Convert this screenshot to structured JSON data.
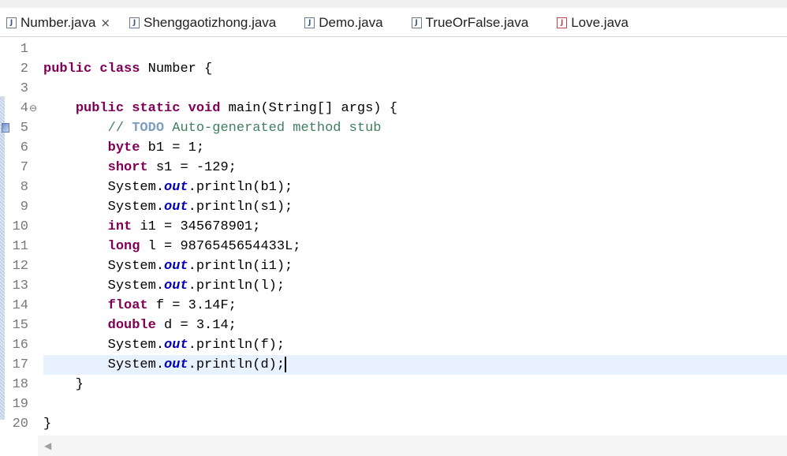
{
  "tabs": [
    {
      "label": "Number.java",
      "active": true,
      "icon": "java-file-icon",
      "icon_glyph": "J",
      "closable": true
    },
    {
      "label": "Shenggaotizhong.java",
      "active": false,
      "icon": "java-file-icon",
      "icon_glyph": "J"
    },
    {
      "label": "Demo.java",
      "active": false,
      "icon": "java-file-icon",
      "icon_glyph": "J"
    },
    {
      "label": "TrueOrFalse.java",
      "active": false,
      "icon": "java-file-icon",
      "icon_glyph": "J"
    },
    {
      "label": "Love.java",
      "active": false,
      "icon": "java-error-file-icon",
      "icon_glyph": "J"
    }
  ],
  "close_glyph": "×",
  "editor": {
    "current_line": 17,
    "fold_glyph": "⊖",
    "scroll_left_glyph": "◀",
    "lines": [
      {
        "n": "1",
        "tokens": []
      },
      {
        "n": "2",
        "tokens": [
          {
            "t": "public",
            "c": "kw"
          },
          {
            "t": " "
          },
          {
            "t": "class",
            "c": "kw"
          },
          {
            "t": " Number {"
          }
        ]
      },
      {
        "n": "3",
        "tokens": []
      },
      {
        "n": "4",
        "fold": true,
        "tokens": [
          {
            "t": "    "
          },
          {
            "t": "public",
            "c": "kw"
          },
          {
            "t": " "
          },
          {
            "t": "static",
            "c": "kw"
          },
          {
            "t": " "
          },
          {
            "t": "void",
            "c": "kw"
          },
          {
            "t": " main(String[] args) {"
          }
        ]
      },
      {
        "n": "5",
        "marker": true,
        "tokens": [
          {
            "t": "        "
          },
          {
            "t": "// ",
            "c": "cm"
          },
          {
            "t": "TODO",
            "c": "todo"
          },
          {
            "t": " Auto-generated method stub",
            "c": "cm"
          }
        ]
      },
      {
        "n": "6",
        "tokens": [
          {
            "t": "        "
          },
          {
            "t": "byte",
            "c": "kw"
          },
          {
            "t": " b1 = 1;"
          }
        ]
      },
      {
        "n": "7",
        "tokens": [
          {
            "t": "        "
          },
          {
            "t": "short",
            "c": "kw"
          },
          {
            "t": " s1 = -129;"
          }
        ]
      },
      {
        "n": "8",
        "tokens": [
          {
            "t": "        System."
          },
          {
            "t": "out",
            "c": "fld"
          },
          {
            "t": ".println(b1);"
          }
        ]
      },
      {
        "n": "9",
        "tokens": [
          {
            "t": "        System."
          },
          {
            "t": "out",
            "c": "fld"
          },
          {
            "t": ".println(s1);"
          }
        ]
      },
      {
        "n": "10",
        "tokens": [
          {
            "t": "        "
          },
          {
            "t": "int",
            "c": "kw"
          },
          {
            "t": " i1 = 345678901;"
          }
        ]
      },
      {
        "n": "11",
        "tokens": [
          {
            "t": "        "
          },
          {
            "t": "long",
            "c": "kw"
          },
          {
            "t": " l = 9876545654433L;"
          }
        ]
      },
      {
        "n": "12",
        "tokens": [
          {
            "t": "        System."
          },
          {
            "t": "out",
            "c": "fld"
          },
          {
            "t": ".println(i1);"
          }
        ]
      },
      {
        "n": "13",
        "tokens": [
          {
            "t": "        System."
          },
          {
            "t": "out",
            "c": "fld"
          },
          {
            "t": ".println(l);"
          }
        ]
      },
      {
        "n": "14",
        "tokens": [
          {
            "t": "        "
          },
          {
            "t": "float",
            "c": "kw"
          },
          {
            "t": " f = 3.14F;"
          }
        ]
      },
      {
        "n": "15",
        "tokens": [
          {
            "t": "        "
          },
          {
            "t": "double",
            "c": "kw"
          },
          {
            "t": " d = 3.14;"
          }
        ]
      },
      {
        "n": "16",
        "tokens": [
          {
            "t": "        System."
          },
          {
            "t": "out",
            "c": "fld"
          },
          {
            "t": ".println(f);"
          }
        ]
      },
      {
        "n": "17",
        "caret": true,
        "tokens": [
          {
            "t": "        System."
          },
          {
            "t": "out",
            "c": "fld"
          },
          {
            "t": ".println(d);"
          }
        ]
      },
      {
        "n": "18",
        "tokens": [
          {
            "t": "    }"
          }
        ]
      },
      {
        "n": "19",
        "tokens": []
      },
      {
        "n": "20",
        "tokens": [
          {
            "t": "}"
          }
        ]
      }
    ]
  }
}
